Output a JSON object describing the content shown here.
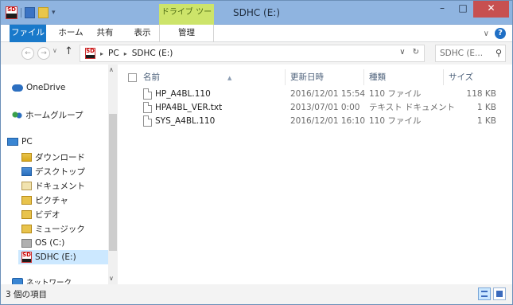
{
  "window": {
    "title": "SDHC (E:)",
    "contextual_tab": "ドライブ ツール"
  },
  "ribbon": {
    "tabs": [
      "ファイル",
      "ホーム",
      "共有",
      "表示",
      "管理"
    ],
    "collapse_icon": "chevron-down-icon",
    "help_label": "?"
  },
  "address": {
    "segments": [
      "PC",
      "SDHC (E:)"
    ],
    "search_placeholder": "SDHC (E...",
    "refresh_icon": "refresh-icon"
  },
  "navpane": {
    "items": [
      {
        "label": "OneDrive",
        "icon": "onedrive-icon"
      },
      {
        "label": "ホームグループ",
        "icon": "homegroup-icon"
      },
      {
        "label": "PC",
        "icon": "pc-icon"
      },
      {
        "label": "ダウンロード",
        "icon": "downloads-folder-icon"
      },
      {
        "label": "デスクトップ",
        "icon": "desktop-folder-icon"
      },
      {
        "label": "ドキュメント",
        "icon": "documents-folder-icon"
      },
      {
        "label": "ピクチャ",
        "icon": "pictures-folder-icon"
      },
      {
        "label": "ビデオ",
        "icon": "videos-folder-icon"
      },
      {
        "label": "ミュージック",
        "icon": "music-folder-icon"
      },
      {
        "label": "OS (C:)",
        "icon": "drive-c-icon"
      },
      {
        "label": "SDHC (E:)",
        "icon": "sd-card-icon",
        "selected": true
      },
      {
        "label": "ネットワーク",
        "icon": "network-icon"
      }
    ]
  },
  "columns": [
    "名前",
    "更新日時",
    "種類",
    "サイズ"
  ],
  "files": [
    {
      "name": "HP_A4BL.110",
      "modified": "2016/12/01 15:54",
      "type": "110 ファイル",
      "size": "118 KB"
    },
    {
      "name": "HPA4BL_VER.txt",
      "modified": "2013/07/01 0:00",
      "type": "テキスト ドキュメント",
      "size": "1 KB"
    },
    {
      "name": "SYS_A4BL.110",
      "modified": "2016/12/01 16:10",
      "type": "110 ファイル",
      "size": "1 KB"
    }
  ],
  "status": {
    "item_count": "3 個の項目"
  },
  "colors": {
    "title_bar": "#8fb4e0",
    "file_tab": "#1979ca",
    "contextual_tab": "#cde46a",
    "close_button": "#c75050",
    "selection": "#cce8ff"
  }
}
